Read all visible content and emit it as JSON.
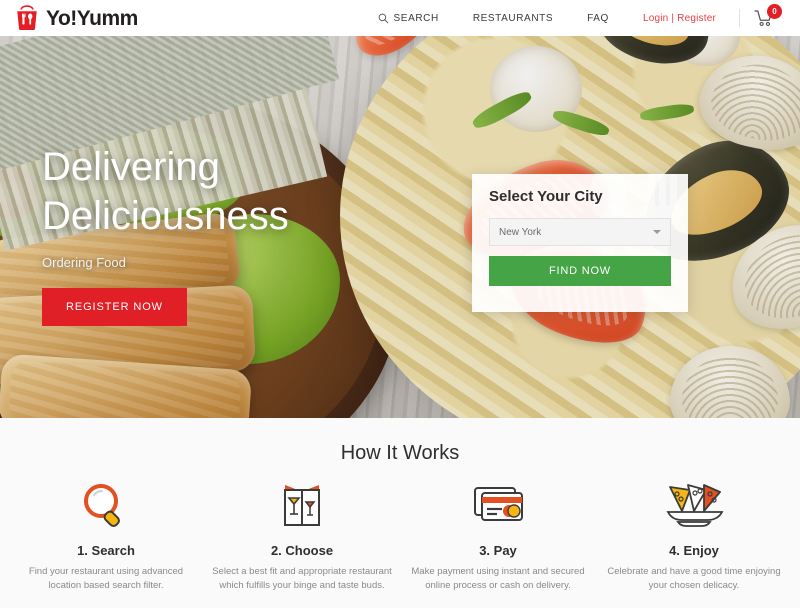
{
  "header": {
    "logo_text": "Yo!Yumm",
    "logo_icon": "takeout-bag-fork-spoon-icon",
    "nav": [
      {
        "label": "SEARCH",
        "icon": "search-icon"
      },
      {
        "label": "RESTAURANTS",
        "icon": ""
      },
      {
        "label": "FAQ",
        "icon": ""
      }
    ],
    "auth_label": "Login | Register",
    "cart": {
      "icon": "shopping-cart-icon",
      "count": "0"
    }
  },
  "hero": {
    "title_line1": "Delivering",
    "title_line2": "Deliciousness",
    "subtitle": "Ordering Food",
    "cta_label": "REGISTER NOW",
    "cta_color": "#e01f26"
  },
  "city_card": {
    "title": "Select Your City",
    "select_value": "New York",
    "select_icon": "chevron-down-icon",
    "button_label": "FIND NOW",
    "button_color": "#45a546",
    "watermark_icon": "spoon-fork-watermark-icon"
  },
  "how_it_works": {
    "title": "How It Works",
    "steps": [
      {
        "icon": "magnifier-icon",
        "title": "1. Search",
        "desc": "Find your restaurant using advanced location based search filter."
      },
      {
        "icon": "menu-card-cocktails-icon",
        "title": "2. Choose",
        "desc": "Select a best fit and appropriate restaurant which fulfills your binge and taste buds."
      },
      {
        "icon": "credit-cards-icon",
        "title": "3. Pay",
        "desc": "Make payment using instant and secured online process or cash on delivery."
      },
      {
        "icon": "pizza-slices-plate-icon",
        "title": "4. Enjoy",
        "desc": "Celebrate and have a good time enjoying your chosen delicacy."
      }
    ]
  }
}
